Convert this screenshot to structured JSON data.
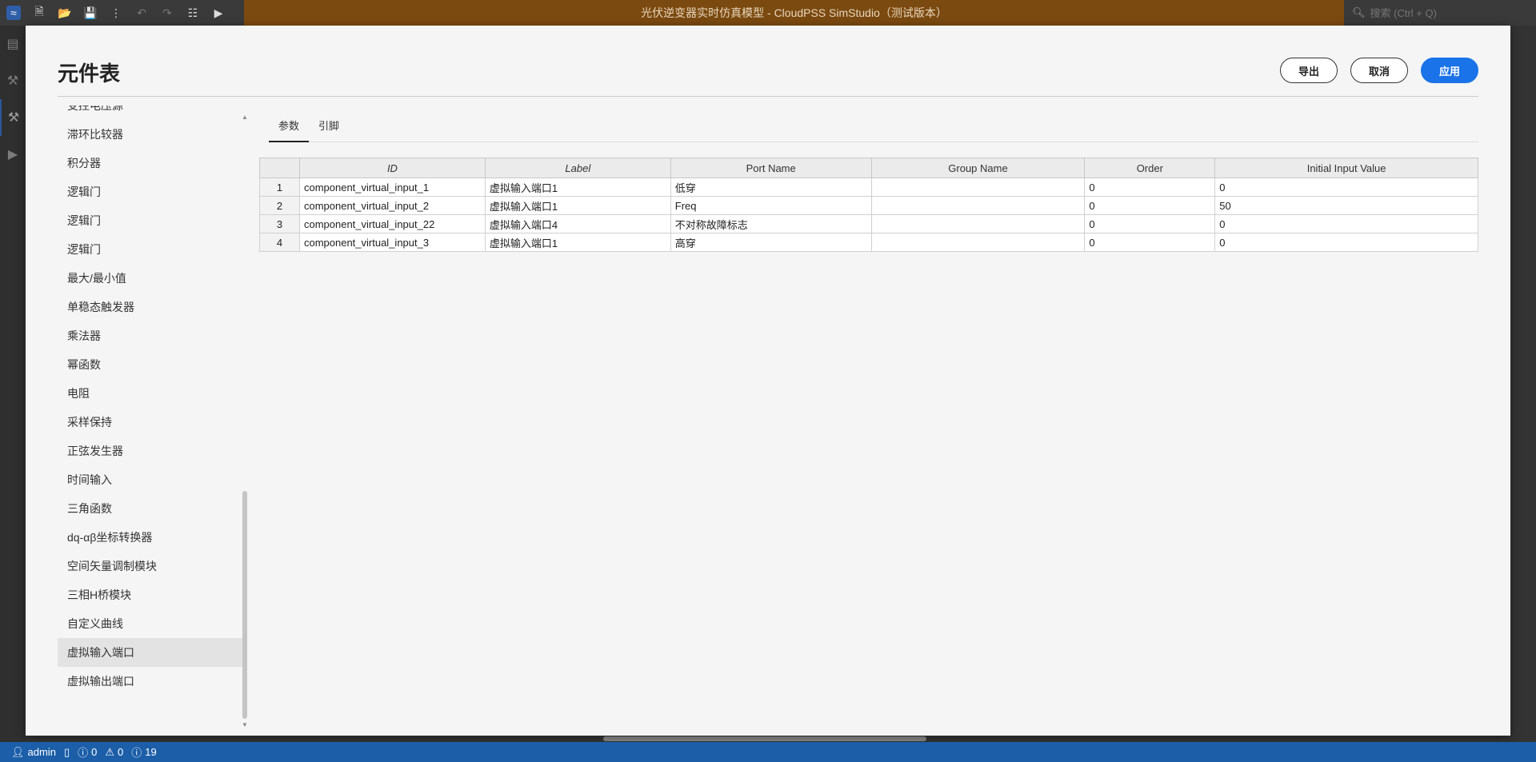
{
  "app": {
    "title": "光伏逆变器实时仿真模型 - CloudPSS SimStudio（测试版本）",
    "search_placeholder": "搜索 (Ctrl + Q)"
  },
  "dialog": {
    "title": "元件表",
    "buttons": {
      "export": "导出",
      "cancel": "取消",
      "apply": "应用"
    }
  },
  "components": [
    "受控电压源",
    "滞环比较器",
    "积分器",
    "逻辑门",
    "逻辑门",
    "逻辑门",
    "最大/最小值",
    "单稳态触发器",
    "乘法器",
    "幂函数",
    "电阻",
    "采样保持",
    "正弦发生器",
    "时间输入",
    "三角函数",
    "dq-αβ坐标转换器",
    "空间矢量调制模块",
    "三相H桥模块",
    "自定义曲线",
    "虚拟输入端口",
    "虚拟输出端口"
  ],
  "selected_component": "虚拟输入端口",
  "tabs": [
    "参数",
    "引脚"
  ],
  "table": {
    "columns": [
      "",
      "ID",
      "Label",
      "Port Name",
      "Group Name",
      "Order",
      "Initial Input Value"
    ],
    "rows": [
      [
        "1",
        "component_virtual_input_1",
        "虚拟输入端口1",
        "低穿",
        "",
        "0",
        "0"
      ],
      [
        "2",
        "component_virtual_input_2",
        "虚拟输入端口1",
        "Freq",
        "",
        "0",
        "50"
      ],
      [
        "3",
        "component_virtual_input_22",
        "虚拟输入端口4",
        "不对称故障标志",
        "",
        "0",
        "0"
      ],
      [
        "4",
        "component_virtual_input_3",
        "虚拟输入端口1",
        "高穿",
        "",
        "0",
        "0"
      ]
    ]
  },
  "status": {
    "user": "admin",
    "errors": "0",
    "warnings": "0",
    "infos": "19"
  },
  "colors": {
    "title_bar": "#7b4a10",
    "status_bar": "#1c5ea8",
    "primary": "#1a73e8"
  }
}
